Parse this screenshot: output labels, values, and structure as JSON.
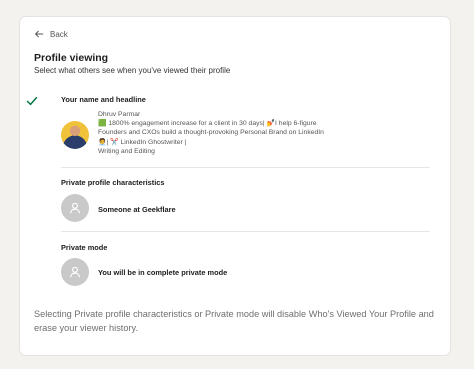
{
  "back": {
    "label": "Back"
  },
  "header": {
    "title": "Profile viewing",
    "subtitle": "Select what others see when you've viewed their profile"
  },
  "options": [
    {
      "label": "Your name and headline",
      "selected": true,
      "name": "Dhruv Parmar",
      "headline": "🟩 1800% engagement increase for a client in 30 days| 💅I help 6-figure Founders and CXOs build a thought-provoking Personal Brand on LinkedIn 🧑‍💼| ✂️ LinkedIn Ghostwriter |",
      "extra": "Writing and Editing"
    },
    {
      "label": "Private profile characteristics",
      "selected": false,
      "description": "Someone at Geekflare"
    },
    {
      "label": "Private mode",
      "selected": false,
      "description": "You will be in complete private mode"
    }
  ],
  "footer": {
    "note": "Selecting Private profile characteristics or Private mode will disable Who's Viewed Your Profile and erase your viewer history."
  },
  "colors": {
    "check": "#057642",
    "page_bg": "#f3f2ef",
    "card_bg": "#ffffff"
  }
}
